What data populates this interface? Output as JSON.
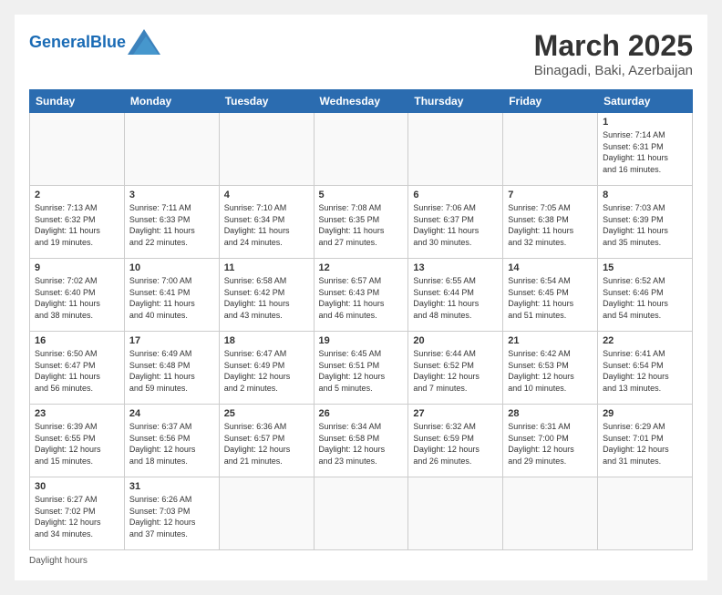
{
  "header": {
    "logo_general": "General",
    "logo_blue": "Blue",
    "month_title": "March 2025",
    "location": "Binagadi, Baki, Azerbaijan"
  },
  "weekdays": [
    "Sunday",
    "Monday",
    "Tuesday",
    "Wednesday",
    "Thursday",
    "Friday",
    "Saturday"
  ],
  "footer": {
    "daylight_label": "Daylight hours"
  },
  "weeks": [
    [
      {
        "day": "",
        "info": ""
      },
      {
        "day": "",
        "info": ""
      },
      {
        "day": "",
        "info": ""
      },
      {
        "day": "",
        "info": ""
      },
      {
        "day": "",
        "info": ""
      },
      {
        "day": "",
        "info": ""
      },
      {
        "day": "1",
        "info": "Sunrise: 7:14 AM\nSunset: 6:31 PM\nDaylight: 11 hours\nand 16 minutes."
      }
    ],
    [
      {
        "day": "2",
        "info": "Sunrise: 7:13 AM\nSunset: 6:32 PM\nDaylight: 11 hours\nand 19 minutes."
      },
      {
        "day": "3",
        "info": "Sunrise: 7:11 AM\nSunset: 6:33 PM\nDaylight: 11 hours\nand 22 minutes."
      },
      {
        "day": "4",
        "info": "Sunrise: 7:10 AM\nSunset: 6:34 PM\nDaylight: 11 hours\nand 24 minutes."
      },
      {
        "day": "5",
        "info": "Sunrise: 7:08 AM\nSunset: 6:35 PM\nDaylight: 11 hours\nand 27 minutes."
      },
      {
        "day": "6",
        "info": "Sunrise: 7:06 AM\nSunset: 6:37 PM\nDaylight: 11 hours\nand 30 minutes."
      },
      {
        "day": "7",
        "info": "Sunrise: 7:05 AM\nSunset: 6:38 PM\nDaylight: 11 hours\nand 32 minutes."
      },
      {
        "day": "8",
        "info": "Sunrise: 7:03 AM\nSunset: 6:39 PM\nDaylight: 11 hours\nand 35 minutes."
      }
    ],
    [
      {
        "day": "9",
        "info": "Sunrise: 7:02 AM\nSunset: 6:40 PM\nDaylight: 11 hours\nand 38 minutes."
      },
      {
        "day": "10",
        "info": "Sunrise: 7:00 AM\nSunset: 6:41 PM\nDaylight: 11 hours\nand 40 minutes."
      },
      {
        "day": "11",
        "info": "Sunrise: 6:58 AM\nSunset: 6:42 PM\nDaylight: 11 hours\nand 43 minutes."
      },
      {
        "day": "12",
        "info": "Sunrise: 6:57 AM\nSunset: 6:43 PM\nDaylight: 11 hours\nand 46 minutes."
      },
      {
        "day": "13",
        "info": "Sunrise: 6:55 AM\nSunset: 6:44 PM\nDaylight: 11 hours\nand 48 minutes."
      },
      {
        "day": "14",
        "info": "Sunrise: 6:54 AM\nSunset: 6:45 PM\nDaylight: 11 hours\nand 51 minutes."
      },
      {
        "day": "15",
        "info": "Sunrise: 6:52 AM\nSunset: 6:46 PM\nDaylight: 11 hours\nand 54 minutes."
      }
    ],
    [
      {
        "day": "16",
        "info": "Sunrise: 6:50 AM\nSunset: 6:47 PM\nDaylight: 11 hours\nand 56 minutes."
      },
      {
        "day": "17",
        "info": "Sunrise: 6:49 AM\nSunset: 6:48 PM\nDaylight: 11 hours\nand 59 minutes."
      },
      {
        "day": "18",
        "info": "Sunrise: 6:47 AM\nSunset: 6:49 PM\nDaylight: 12 hours\nand 2 minutes."
      },
      {
        "day": "19",
        "info": "Sunrise: 6:45 AM\nSunset: 6:51 PM\nDaylight: 12 hours\nand 5 minutes."
      },
      {
        "day": "20",
        "info": "Sunrise: 6:44 AM\nSunset: 6:52 PM\nDaylight: 12 hours\nand 7 minutes."
      },
      {
        "day": "21",
        "info": "Sunrise: 6:42 AM\nSunset: 6:53 PM\nDaylight: 12 hours\nand 10 minutes."
      },
      {
        "day": "22",
        "info": "Sunrise: 6:41 AM\nSunset: 6:54 PM\nDaylight: 12 hours\nand 13 minutes."
      }
    ],
    [
      {
        "day": "23",
        "info": "Sunrise: 6:39 AM\nSunset: 6:55 PM\nDaylight: 12 hours\nand 15 minutes."
      },
      {
        "day": "24",
        "info": "Sunrise: 6:37 AM\nSunset: 6:56 PM\nDaylight: 12 hours\nand 18 minutes."
      },
      {
        "day": "25",
        "info": "Sunrise: 6:36 AM\nSunset: 6:57 PM\nDaylight: 12 hours\nand 21 minutes."
      },
      {
        "day": "26",
        "info": "Sunrise: 6:34 AM\nSunset: 6:58 PM\nDaylight: 12 hours\nand 23 minutes."
      },
      {
        "day": "27",
        "info": "Sunrise: 6:32 AM\nSunset: 6:59 PM\nDaylight: 12 hours\nand 26 minutes."
      },
      {
        "day": "28",
        "info": "Sunrise: 6:31 AM\nSunset: 7:00 PM\nDaylight: 12 hours\nand 29 minutes."
      },
      {
        "day": "29",
        "info": "Sunrise: 6:29 AM\nSunset: 7:01 PM\nDaylight: 12 hours\nand 31 minutes."
      }
    ],
    [
      {
        "day": "30",
        "info": "Sunrise: 6:27 AM\nSunset: 7:02 PM\nDaylight: 12 hours\nand 34 minutes."
      },
      {
        "day": "31",
        "info": "Sunrise: 6:26 AM\nSunset: 7:03 PM\nDaylight: 12 hours\nand 37 minutes."
      },
      {
        "day": "",
        "info": ""
      },
      {
        "day": "",
        "info": ""
      },
      {
        "day": "",
        "info": ""
      },
      {
        "day": "",
        "info": ""
      },
      {
        "day": "",
        "info": ""
      }
    ]
  ]
}
